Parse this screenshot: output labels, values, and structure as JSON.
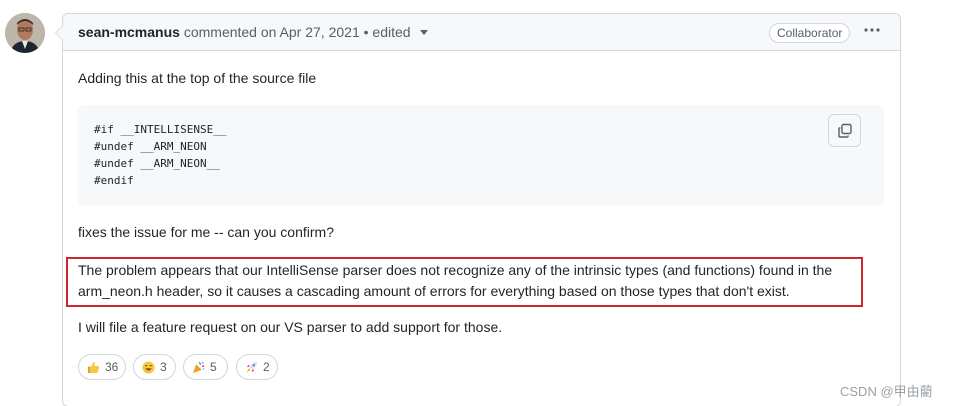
{
  "comment": {
    "author": "sean-mcmanus",
    "meta_text": "commented on Apr 27, 2021 • edited",
    "role_badge": "Collaborator",
    "more_icon": "kebab-horizontal-icon",
    "paragraph_1": "Adding this at the top of the source file",
    "code_lines": [
      "#if __INTELLISENSE__",
      "#undef __ARM_NEON",
      "#undef __ARM_NEON__",
      "#endif"
    ],
    "copy_icon": "copy-icon",
    "paragraph_2": "fixes the issue for me -- can you confirm?",
    "highlighted_lines": [
      "The problem appears that our IntelliSense parser does not recognize any of the intrinsic types (and functions) found in the",
      "arm_neon.h header, so it causes a cascading amount of errors for everything based on those types that don't exist."
    ],
    "paragraph_4": "I will file a feature request on our VS parser to add support for those.",
    "reactions": [
      {
        "icon": "thumbs-up-icon",
        "count": "36"
      },
      {
        "icon": "smile-icon",
        "count": "3"
      },
      {
        "icon": "tada-icon",
        "count": "5"
      },
      {
        "icon": "rocket-icon",
        "count": "2"
      }
    ]
  },
  "watermark": "CSDN @甲由藺",
  "colors": {
    "border": "#d0d7de",
    "header_bg": "#f6f8fa",
    "highlight": "#d1242f",
    "text": "#1f2328",
    "muted": "#57606a"
  }
}
